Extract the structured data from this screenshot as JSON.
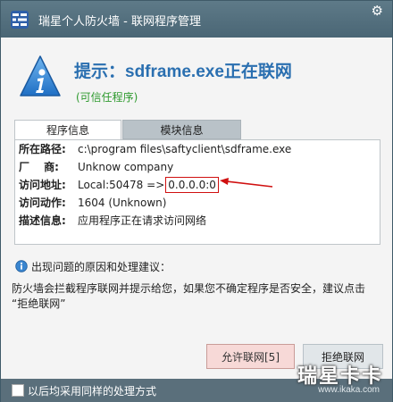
{
  "window": {
    "title": "瑞星个人防火墙 - 联网程序管理",
    "settings_icon": "gear-icon",
    "logo_icon": "firewall-shield-icon"
  },
  "header": {
    "headline": "提示：sdframe.exe正在联网",
    "trust_status": "(可信任程序)",
    "icon": "info-icon"
  },
  "tabs": [
    {
      "label": "程序信息",
      "active": true
    },
    {
      "label": "模块信息",
      "active": false
    }
  ],
  "program_info": {
    "path_label": "所在路径:",
    "path_value": "c:\\program files\\saftyclient\\sdframe.exe",
    "vendor_label": "厂　 商:",
    "vendor_value": "Unknow company",
    "address_label": "访问地址:",
    "address_local": "Local:50478 =>",
    "address_remote": "0.0.0.0:0",
    "action_label": "访问动作:",
    "action_value": "1604 (Unknown)",
    "desc_label": "描述信息:",
    "desc_value": "应用程序正在请求访问网络"
  },
  "advice": {
    "heading": "出现问题的原因和处理建议：",
    "icon": "bulb-info-icon",
    "text_line1": "防火墙会拦截程序联网并提示给您，如果您不确定程序是否安全，建议点击",
    "text_line2": "“拒绝联网”"
  },
  "buttons": {
    "allow": "允许联网[5]",
    "deny": "拒绝联网"
  },
  "footer": {
    "checkbox_label": "以后均采用同样的处理方式",
    "checked": false
  },
  "watermark": {
    "brand": "瑞星卡卡",
    "url": "www.ikaka.com"
  },
  "colors": {
    "headline": "#2a6fb0",
    "trust": "#2e9a2e",
    "highlight": "#d01010",
    "titlebar": "#4a6675"
  }
}
